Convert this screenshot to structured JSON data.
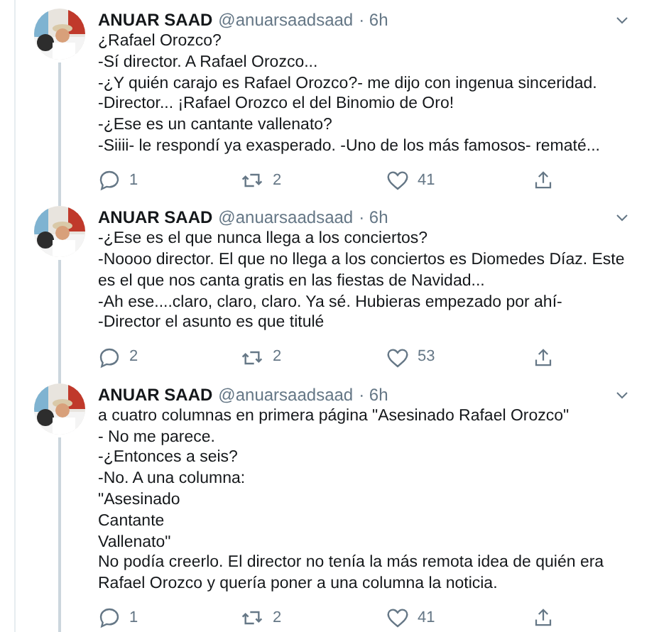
{
  "tweets": [
    {
      "name": "ANUAR SAAD",
      "handle": "@anuarsaadsaad",
      "time": "· 6h",
      "text": "¿Rafael Orozco?\n-Sí director. A Rafael Orozco...\n-¿Y quién carajo es Rafael Orozco?- me dijo con ingenua sinceridad.\n-Director... ¡Rafael Orozco el del Binomio de Oro!\n-¿Ese es un cantante vallenato?\n-Siiii- le respondí ya exasperado. -Uno de los más famosos- rematé...",
      "replies": "1",
      "retweets": "2",
      "likes": "41"
    },
    {
      "name": "ANUAR SAAD",
      "handle": "@anuarsaadsaad",
      "time": "· 6h",
      "text": "-¿Ese es el que nunca llega a los conciertos?\n-Noooo director. El que no llega a los conciertos es Diomedes Díaz. Este es el que nos canta gratis en las fiestas de Navidad...\n-Ah ese....claro, claro, claro. Ya sé. Hubieras empezado por ahí-\n-Director el asunto es que titulé",
      "replies": "2",
      "retweets": "2",
      "likes": "53"
    },
    {
      "name": "ANUAR SAAD",
      "handle": "@anuarsaadsaad",
      "time": "· 6h",
      "text": "a cuatro columnas en primera página \"Asesinado Rafael Orozco\"\n- No me parece.\n-¿Entonces a seis?\n-No. A una columna:\n\"Asesinado\nCantante\nVallenato\"\nNo podía creerlo. El director no tenía la más remota idea de quién era Rafael Orozco y quería poner a una columna la noticia.",
      "replies": "1",
      "retweets": "2",
      "likes": "41"
    }
  ]
}
